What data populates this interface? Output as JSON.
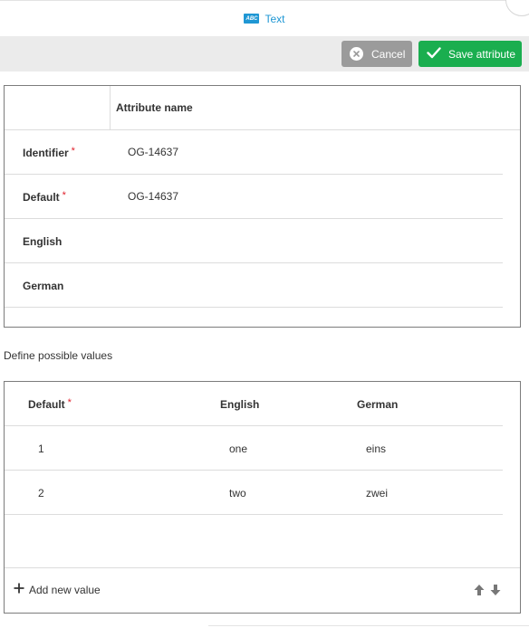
{
  "header": {
    "type_icon_text": "ABC",
    "type_label": "Text"
  },
  "toolbar": {
    "cancel_label": "Cancel",
    "save_label": "Save attribute"
  },
  "attributes": {
    "column_header": "Attribute name",
    "required_marker": "*",
    "rows": [
      {
        "label": "Identifier",
        "value": "OG-14637"
      },
      {
        "label": "Default",
        "value": "OG-14637"
      },
      {
        "label": "English",
        "value": ""
      },
      {
        "label": "German",
        "value": ""
      }
    ]
  },
  "possible_values": {
    "section_label": "Define possible values",
    "headers": [
      "Default",
      "English",
      "German"
    ],
    "rows": [
      [
        "1",
        "one",
        "eins"
      ],
      [
        "2",
        "two",
        "zwei"
      ]
    ],
    "add_label": "Add new value"
  },
  "colors": {
    "accent_blue": "#1f97d4",
    "save_green": "#1aae4f",
    "cancel_grey": "#9b9b9b",
    "required_red": "#e0202b"
  },
  "icons": {
    "type": "text-type-icon",
    "cancel": "close-circle-icon",
    "save": "checkmark-icon",
    "add": "plus-icon",
    "move_up": "arrow-up-icon",
    "move_down": "arrow-down-icon"
  }
}
